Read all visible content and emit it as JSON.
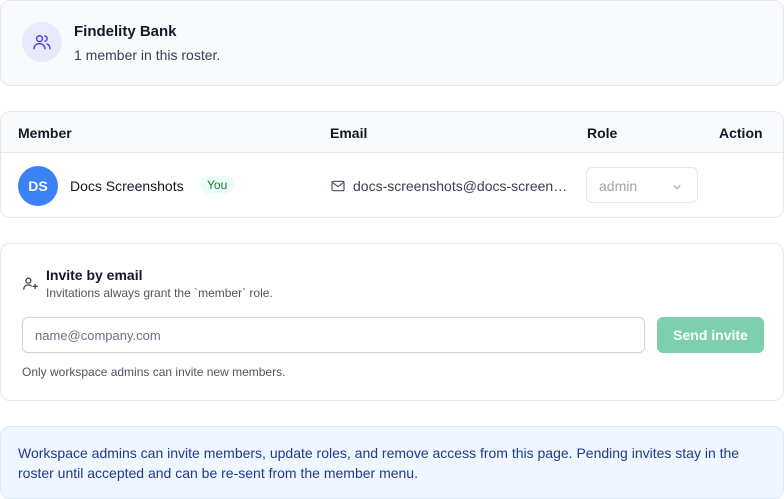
{
  "workspace": {
    "name": "Findelity Bank",
    "summary": "1 member in this roster.",
    "icon": "users-icon"
  },
  "table": {
    "headers": {
      "member": "Member",
      "email": "Email",
      "role": "Role",
      "action": "Action"
    },
    "rows": [
      {
        "initials": "DS",
        "name": "Docs Screenshots",
        "badge": "You",
        "email": "docs-screenshots@docs-screenshots.example",
        "email_icon": "mail-icon",
        "role": "admin"
      }
    ]
  },
  "invite": {
    "title": "Invite by email",
    "subtitle": "Invitations always grant the `member` role.",
    "icon": "user-plus-icon",
    "placeholder": "name@company.com",
    "button_label": "Send invite",
    "note": "Only workspace admins can invite new members."
  },
  "info": {
    "text": "Workspace admins can invite members, update roles, and remove access from this page. Pending invites stay in the roster until accepted and can be re-sent from the member menu."
  },
  "colors": {
    "avatar": "#3b82f6",
    "send_button": "#7ecfb0",
    "info_background": "#eff6ff",
    "info_text": "#1e3a8a"
  }
}
